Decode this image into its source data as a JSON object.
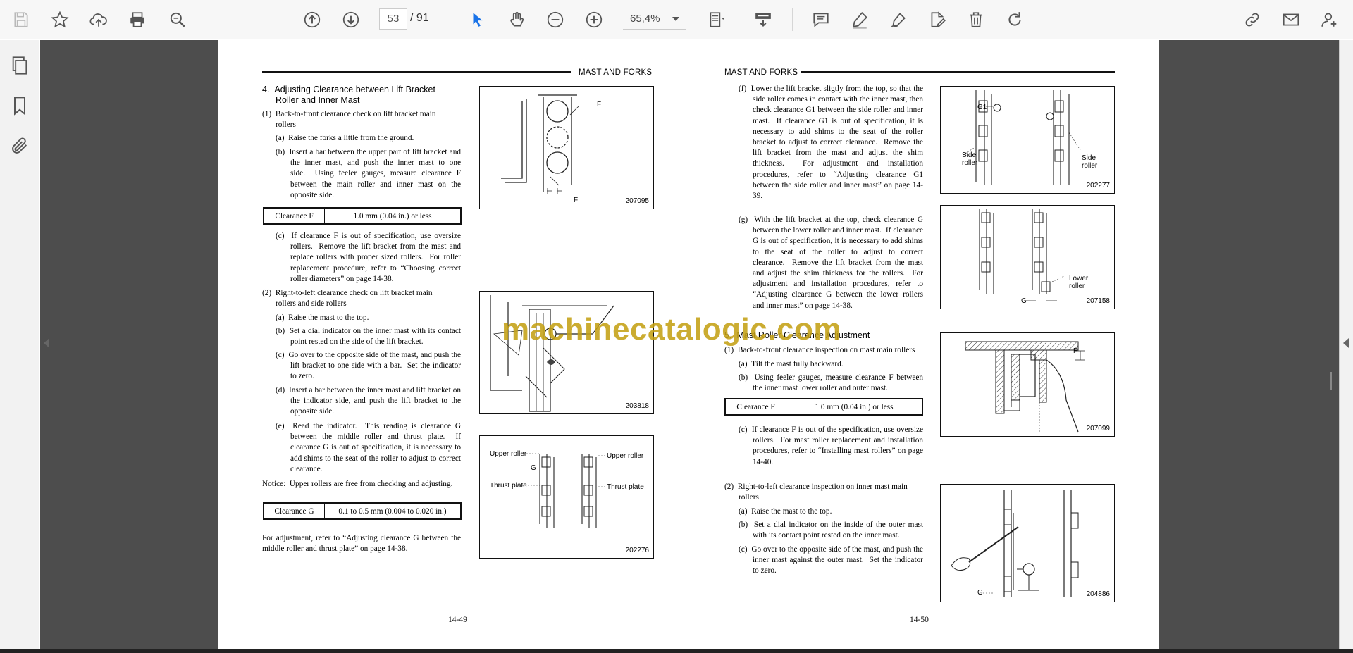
{
  "toolbar": {
    "current_page": "53",
    "total_pages": "/ 91",
    "zoom": "65,4%"
  },
  "left_page": {
    "header": "MAST AND FORKS",
    "section_title_1": "4.  Adjusting Clearance between Lift Bracket",
    "section_title_2": "Roller and Inner Mast",
    "item1_title_a": "(1)  Back-to-front clearance check on lift bracket main",
    "item1_title_b": "rollers",
    "item1_a": "(a)  Raise the forks a little from the ground.",
    "item1_b": "(b)  Insert a bar between the upper part of lift bracket and the inner mast, and push the inner mast to one side.  Using feeler gauges, measure clearance F between the main roller and inner mast on the opposite side.",
    "table1_label": "Clearance F",
    "table1_value": "1.0 mm (0.04 in.) or less",
    "item1_c": "(c)  If clearance F is out of specification, use oversize rollers.  Remove the lift bracket from the mast and replace rollers with proper sized rollers.  For roller replacement procedure, refer to “Choosing correct roller diameters” on page 14-38.",
    "item2_title_a": "(2)  Right-to-left clearance check on lift bracket main",
    "item2_title_b": "rollers and side rollers",
    "item2_a": "(a)  Raise the mast to the top.",
    "item2_b": "(b)  Set a dial indicator on the inner mast with its contact point rested on the side of the lift bracket.",
    "item2_c": "(c)  Go over to the opposite side of the mast, and push the lift bracket to one side with a bar.  Set the indicator to zero.",
    "item2_d": "(d)  Insert a bar between the inner mast and lift bracket on the indicator side, and push the lift bracket to the opposite side.",
    "item2_e": "(e)  Read the indicator.  This reading is clearance G between the middle roller and thrust plate.  If clearance G is out of specification, it is necessary to add shims to the seat of the roller to adjust to correct clearance.",
    "notice": "Notice:  Upper rollers are free from checking and adjusting.",
    "table2_label": "Clearance G",
    "table2_value": "0.1 to 0.5 mm (0.004 to 0.020 in.)",
    "adjust_note": "For adjustment, refer to “Adjusting clearance G between the middle roller and thrust plate” on page 14-38.",
    "fig1_num": "207095",
    "fig1_F": "F",
    "fig1_F2": "F",
    "fig2_num": "203818",
    "fig3_num": "202276",
    "fig3_upper_l": "Upper roller",
    "fig3_upper_r": "Upper roller",
    "fig3_G": "G",
    "fig3_thrust_l": "Thrust plate",
    "fig3_thrust_r": "Thrust plate",
    "page_number": "14-49"
  },
  "right_page": {
    "header": "MAST AND FORKS",
    "item_f": "(f)  Lower the lift bracket sligtly from the top, so that the side roller comes in contact with the inner mast, then check clearance G1 between the side roller and inner mast.  If clearance G1 is out of specification, it is necessary to add shims to the seat of the roller bracket to adjust to correct clearance.  Remove the lift bracket from the mast and adjust the shim thickness.  For adjustment and installation procedures, refer to “Adjusting clearance G1 between the side roller and inner mast” on page 14-39.",
    "item_g": "(g)  With the lift bracket at the top, check clearance G between the lower roller and inner mast.  If clearance G is out of specification, it is necessary to add shims to the seat of the roller to adjust to correct clearance.  Remove the lift bracket from the mast and adjust the shim thickness for the rollers.  For adjustment and installation procedures, refer to “Adjusting clearance G between the lower rollers and inner mast” on page 14-38.",
    "section5_title": "5.  Mast Roller Clearance Adjustment",
    "s5_item1_title": "(1)  Back-to-front clearance inspection on mast main rollers",
    "s5_item1_a": "(a)  Tilt the mast fully backward.",
    "s5_item1_b": "(b)  Using feeler gauges, measure clearance F between the inner mast lower roller and outer mast.",
    "table3_label": "Clearance F",
    "table3_value": "1.0 mm (0.04 in.) or less",
    "s5_item1_c": "(c)  If clearance F is out of the specification, use oversize rollers.  For mast roller replacement and installation procedures, refer to “Installing mast rollers” on page 14-40.",
    "s5_item2_title_a": "(2)  Right-to-left clearance inspection on inner mast main",
    "s5_item2_title_b": "rollers",
    "s5_item2_a": "(a)  Raise the mast to the top.",
    "s5_item2_b": "(b)  Set a dial indicator on the inside of the outer mast with its contact point rested on the inner mast.",
    "s5_item2_c": "(c)  Go over to the opposite side of the mast, and push the inner mast against the outer mast.  Set the indicator to zero.",
    "fig4_num": "202277",
    "fig4_G1": "G1",
    "fig4_side_l": "Side\nroller",
    "fig4_side_r": "Side\nroller",
    "fig5_num": "207158",
    "fig5_lower": "Lower\nroller",
    "fig5_G": "G",
    "fig6_num": "207099",
    "fig6_F": "F",
    "fig7_num": "204886",
    "fig7_G": "G",
    "page_number": "14-50"
  },
  "watermark": "machinecatalogic.com"
}
